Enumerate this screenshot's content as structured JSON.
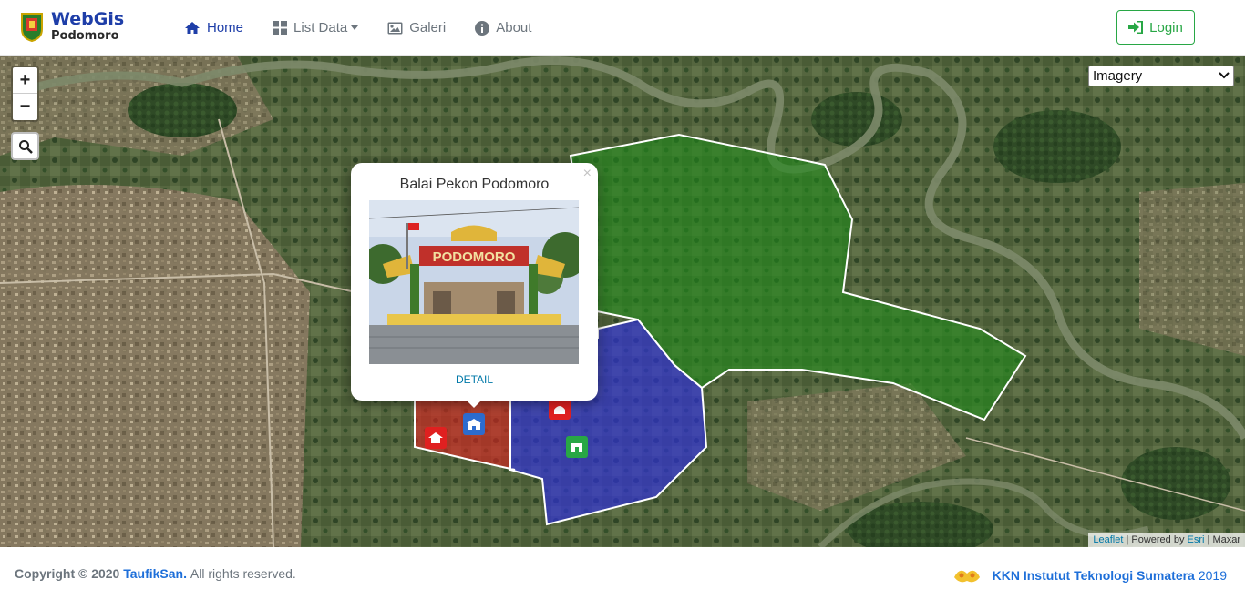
{
  "brand": {
    "title": "WebGis",
    "subtitle": "Podomoro"
  },
  "nav": {
    "items": [
      {
        "label": "Home",
        "icon": "home-icon",
        "active": true
      },
      {
        "label": "List Data",
        "icon": "grid-icon",
        "dropdown": true
      },
      {
        "label": "Galeri",
        "icon": "image-icon"
      },
      {
        "label": "About",
        "icon": "info-icon"
      }
    ],
    "login_label": "Login"
  },
  "map": {
    "basemap_selected": "Imagery",
    "zoom_in": "+",
    "zoom_out": "−",
    "popup": {
      "close": "×",
      "title": "Balai Pekon Podomoro",
      "photo_sign": "PODOMORO",
      "link": "DETAIL"
    },
    "attribution": {
      "leaflet": "Leaflet",
      "sep1": " | Powered by ",
      "esri": "Esri",
      "sep2": " | Maxar"
    },
    "region_colors": {
      "green": "#1f8a1a",
      "blue": "#2e2ee0",
      "red": "#e02020"
    }
  },
  "footer": {
    "copyright": "Copyright © 2020",
    "author": "TaufikSan.",
    "rights": "All rights reserved.",
    "kkn": "KKN Instutut Teknologi Sumatera",
    "year": "2019"
  }
}
